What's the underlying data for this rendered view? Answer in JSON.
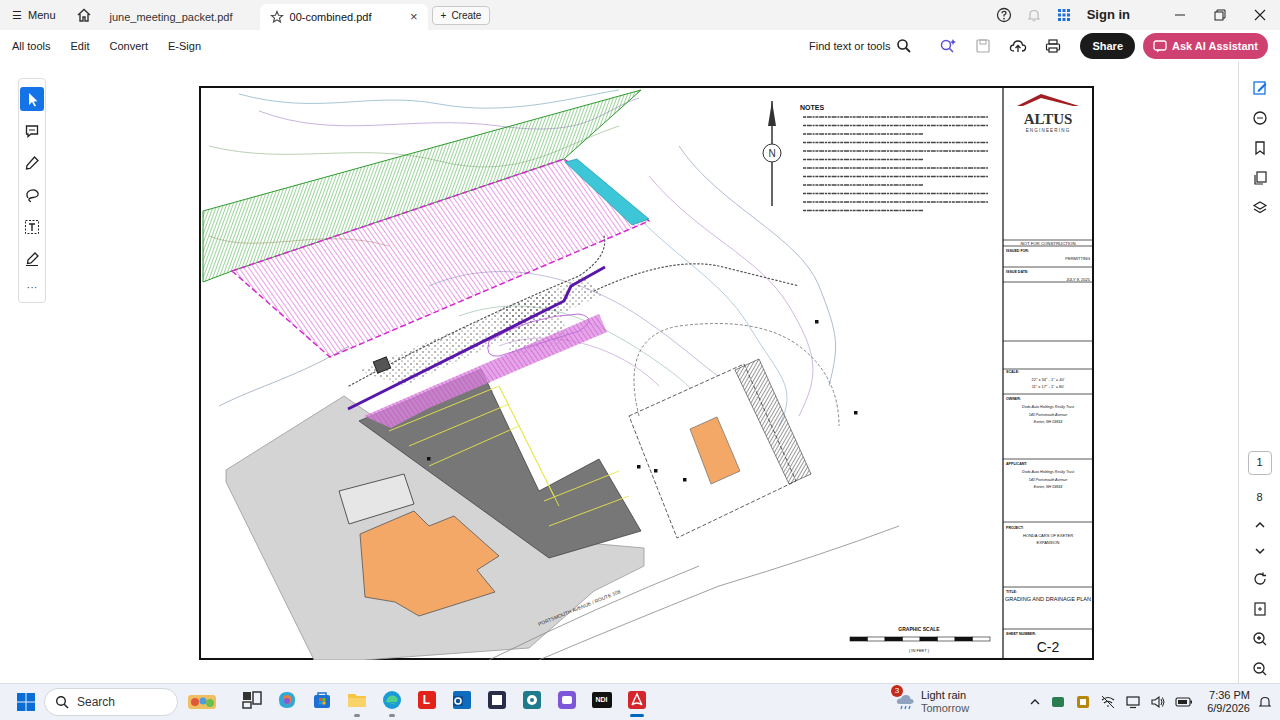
{
  "title_bar": {
    "menu_icon": "☰",
    "menu": "Menu",
    "create_icon": "+",
    "create": "Create",
    "sign_in": "Sign in"
  },
  "tabs": [
    {
      "label": "june_meeting_packet.pdf",
      "selected": false
    },
    {
      "label": "00-combined.pdf",
      "selected": true,
      "close": "×"
    }
  ],
  "toolbar": {
    "items": [
      "All tools",
      "Edit",
      "Convert",
      "E-Sign"
    ],
    "find": "Find text or tools",
    "share": "Share",
    "ai": "Ask AI Assistant"
  },
  "left_tools": [
    {
      "selected": true
    },
    {
      "selected": false
    },
    {
      "selected": false
    },
    {
      "selected": false
    },
    {
      "selected": false
    },
    {
      "selected": false
    }
  ],
  "left_more": "···",
  "page_nav": {
    "current": "1",
    "total": "8"
  },
  "document": {
    "notes_title": "NOTES",
    "north": "N",
    "road": "PORTSMOUTH AVENUE / ROUTE 108",
    "scale_title": "GRAPHIC SCALE",
    "scale_unit": "( IN FEET )",
    "logo": "ALTUS",
    "logo_sub": "ENGINEERING",
    "status": "NOT FOR CONSTRUCTION",
    "blocks": [
      {
        "label": "ISSUED FOR:",
        "lines": [
          "PERMITTING"
        ]
      },
      {
        "label": "ISSUE DATE:",
        "lines": [
          "JULY 8, 2025"
        ]
      },
      {
        "label": "SCALE:",
        "lines": [
          "22\" x 34\" - 1\" = 40'",
          "11\" x 17\" - 1\" = 80'"
        ]
      },
      {
        "label": "OWNER:",
        "lines": [
          "Dodo Auto Holdings Realty Trust",
          "140 Portsmouth Avenue",
          "Exeter, NH 03833"
        ]
      },
      {
        "label": "APPLICANT:",
        "lines": [
          "Dodo Auto Holdings Realty Trust",
          "140 Portsmouth Avenue",
          "Exeter, NH 03833"
        ]
      },
      {
        "label": "PROJECT:",
        "lines": [
          "HONDA CARS OF EXETER",
          "EXPANSION"
        ]
      },
      {
        "label": "TITLE:",
        "lines": [
          "GRADING AND DRAINAGE PLAN"
        ]
      },
      {
        "label": "SHEET NUMBER:",
        "lines": [
          "C-2"
        ]
      }
    ]
  },
  "taskbar": {
    "search": "Search",
    "apps": [
      {
        "running": false,
        "active": false
      },
      {
        "running": false,
        "active": false
      },
      {
        "running": false,
        "active": false
      },
      {
        "running": true,
        "active": false
      },
      {
        "running": true,
        "active": false
      },
      {
        "running": false,
        "active": false,
        "glyph": "L"
      },
      {
        "running": false,
        "active": false
      },
      {
        "running": false,
        "active": false
      },
      {
        "running": false,
        "active": false
      },
      {
        "running": false,
        "active": false
      },
      {
        "running": false,
        "active": false,
        "glyph": "NDI"
      },
      {
        "running": true,
        "active": true
      }
    ],
    "weather": {
      "badge": "3",
      "title": "Light rain",
      "subtitle": "Tomorrow"
    },
    "time": "7:36 PM",
    "date": "6/9/2026"
  }
}
